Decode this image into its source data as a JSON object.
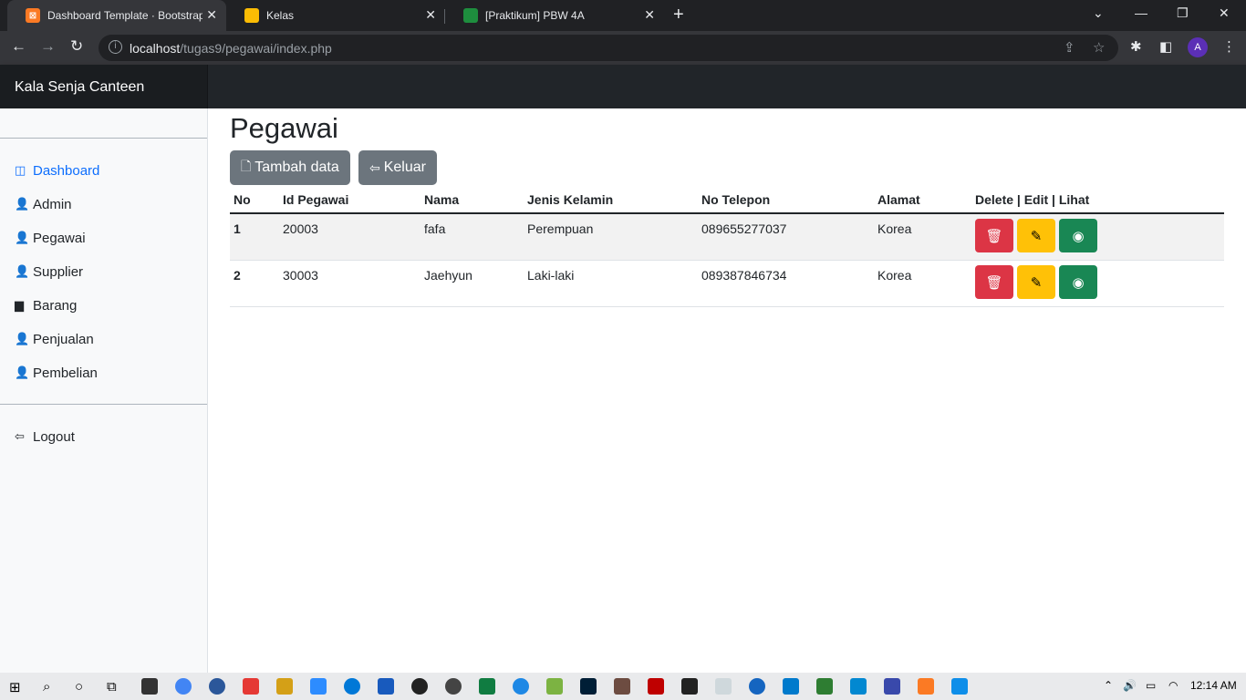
{
  "browser": {
    "tabs": [
      {
        "title": "Dashboard Template · Bootstrap",
        "favicon_color": "#fb7a24",
        "active": true
      },
      {
        "title": "Kelas",
        "favicon_color": "#fbbc04",
        "active": false
      },
      {
        "title": "[Praktikum] PBW 4A",
        "favicon_color": "#1e8e3e",
        "active": false
      }
    ],
    "url_host": "localhost",
    "url_path": "/tugas9/pegawai/index.php",
    "profile_initial": "A"
  },
  "app": {
    "brand": "Kala Senja Canteen"
  },
  "sidebar": {
    "items": [
      {
        "label": "Dashboard",
        "icon": "layout-icon",
        "active": true
      },
      {
        "label": "Admin",
        "icon": "user-list-icon"
      },
      {
        "label": "Pegawai",
        "icon": "user-list-icon"
      },
      {
        "label": "Supplier",
        "icon": "user-list-icon"
      },
      {
        "label": "Barang",
        "icon": "briefcase-icon"
      },
      {
        "label": "Penjualan",
        "icon": "user-list-icon"
      },
      {
        "label": "Pembelian",
        "icon": "user-list-icon"
      }
    ],
    "logout": "Logout"
  },
  "main": {
    "title": "Pegawai",
    "add_button": "Tambah data",
    "exit_button": "Keluar",
    "table": {
      "headers": [
        "No",
        "Id Pegawai",
        "Nama",
        "Jenis Kelamin",
        "No Telepon",
        "Alamat",
        "Delete | Edit | Lihat"
      ],
      "rows": [
        {
          "no": "1",
          "id": "20003",
          "nama": "fafa",
          "jk": "Perempuan",
          "telp": "089655277037",
          "alamat": "Korea"
        },
        {
          "no": "2",
          "id": "30003",
          "nama": "Jaehyun",
          "jk": "Laki-laki",
          "telp": "089387846734",
          "alamat": "Korea"
        }
      ]
    }
  },
  "taskbar": {
    "clock": "12:14 AM"
  },
  "colors": {
    "danger": "#dc3545",
    "warning": "#ffc107",
    "success": "#198754",
    "secondary": "#6c757d",
    "primary": "#0d6efd"
  }
}
